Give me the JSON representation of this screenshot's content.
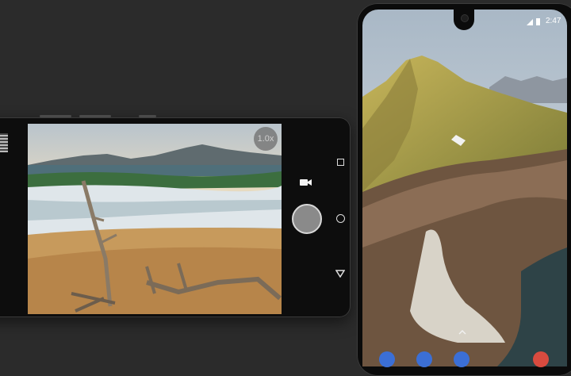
{
  "camera": {
    "zoom_label": "1.0x"
  },
  "status_bar": {
    "time": "2:47"
  },
  "icons": {
    "video": "video-camera-icon",
    "shutter": "shutter-button",
    "nav": [
      "recents-square-icon",
      "home-circle-icon",
      "back-triangle-icon"
    ],
    "status": [
      "wifi-icon",
      "battery-icon"
    ]
  },
  "colors": {
    "background": "#2b2b2b",
    "phone_body": "#0d0d0d",
    "shutter": "#8a8a8a",
    "dock": [
      "#3b6fd6",
      "#3b6fd6",
      "#3b6fd6",
      "#d94b3f"
    ]
  }
}
